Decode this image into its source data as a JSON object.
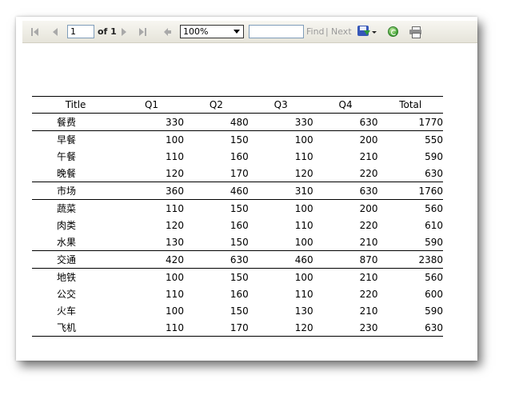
{
  "toolbar": {
    "page_current": "1",
    "page_of": "of 1",
    "zoom": "100%",
    "find_value": "",
    "find_label": "Find",
    "separator": "|",
    "next_label": "Next",
    "icons": {
      "first": "first-page-icon",
      "prev": "previous-page-icon",
      "next": "next-page-icon",
      "last": "last-page-icon",
      "back": "back-to-parent-icon",
      "export": "export-save-icon",
      "refresh": "refresh-icon",
      "print": "print-icon"
    }
  },
  "table": {
    "headers": [
      "Title",
      "Q1",
      "Q2",
      "Q3",
      "Q4",
      "Total"
    ],
    "rows": [
      {
        "kind": "group",
        "cells": [
          "餐费",
          "330",
          "480",
          "330",
          "630",
          "1770"
        ]
      },
      {
        "kind": "item",
        "cells": [
          "早餐",
          "100",
          "150",
          "100",
          "200",
          "550"
        ]
      },
      {
        "kind": "item",
        "cells": [
          "午餐",
          "110",
          "160",
          "110",
          "210",
          "590"
        ]
      },
      {
        "kind": "item",
        "cells": [
          "晚餐",
          "120",
          "170",
          "120",
          "220",
          "630"
        ]
      },
      {
        "kind": "group",
        "cells": [
          "市场",
          "360",
          "460",
          "310",
          "630",
          "1760"
        ]
      },
      {
        "kind": "item",
        "cells": [
          "蔬菜",
          "110",
          "150",
          "100",
          "200",
          "560"
        ]
      },
      {
        "kind": "item",
        "cells": [
          "肉类",
          "120",
          "160",
          "110",
          "220",
          "610"
        ]
      },
      {
        "kind": "item",
        "cells": [
          "水果",
          "130",
          "150",
          "100",
          "210",
          "590"
        ]
      },
      {
        "kind": "group",
        "cells": [
          "交通",
          "420",
          "630",
          "460",
          "870",
          "2380"
        ]
      },
      {
        "kind": "item",
        "cells": [
          "地铁",
          "100",
          "150",
          "100",
          "210",
          "560"
        ]
      },
      {
        "kind": "item",
        "cells": [
          "公交",
          "110",
          "160",
          "110",
          "220",
          "600"
        ]
      },
      {
        "kind": "item",
        "cells": [
          "火车",
          "100",
          "150",
          "130",
          "210",
          "590"
        ]
      },
      {
        "kind": "item",
        "cells": [
          "飞机",
          "110",
          "170",
          "120",
          "230",
          "630"
        ]
      }
    ]
  }
}
